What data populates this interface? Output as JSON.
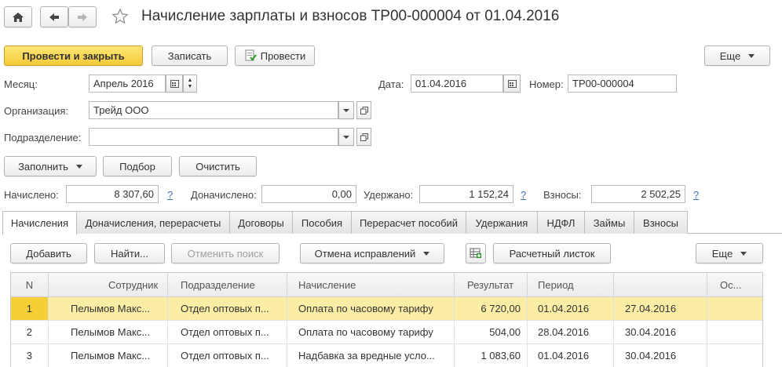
{
  "window": {
    "title": "Начисление зарплаты и взносов ТР00-000004 от 01.04.2016"
  },
  "toolbar": {
    "post_close": "Провести и закрыть",
    "save": "Записать",
    "post": "Провести",
    "more": "Еще"
  },
  "form": {
    "month_label": "Месяц:",
    "month_value": "Апрель 2016",
    "date_label": "Дата:",
    "date_value": "01.04.2016",
    "number_label": "Номер:",
    "number_value": "ТР00-000004",
    "org_label": "Организация:",
    "org_value": "Трейд ООО",
    "dept_label": "Подразделение:",
    "dept_value": ""
  },
  "actions": {
    "fill": "Заполнить",
    "select": "Подбор",
    "clear": "Очистить"
  },
  "totals": {
    "accrued_label": "Начислено:",
    "accrued_value": "8 307,60",
    "extra_label": "Доначислено:",
    "extra_value": "0,00",
    "withheld_label": "Удержано:",
    "withheld_value": "1 152,24",
    "contrib_label": "Взносы:",
    "contrib_value": "2 502,25",
    "help": "?"
  },
  "tabs": [
    {
      "label": "Начисления",
      "active": true
    },
    {
      "label": "Доначисления, перерасчеты"
    },
    {
      "label": "Договоры"
    },
    {
      "label": "Пособия"
    },
    {
      "label": "Перерасчет пособий"
    },
    {
      "label": "Удержания"
    },
    {
      "label": "НДФЛ"
    },
    {
      "label": "Займы"
    },
    {
      "label": "Взносы"
    }
  ],
  "grid_toolbar": {
    "add": "Добавить",
    "find": "Найти...",
    "cancel_search": "Отменить поиск",
    "cancel_corrections": "Отмена исправлений",
    "payslip": "Расчетный листок",
    "more": "Еще"
  },
  "grid": {
    "columns": [
      "N",
      "Сотрудник",
      "Подразделение",
      "Начисление",
      "Результат",
      "Период",
      "",
      "Ос..."
    ],
    "rows": [
      [
        "1",
        "Пелымов Макс...",
        "Отдел оптовых п...",
        "Оплата по часовому тарифу",
        "6 720,00",
        "01.04.2016",
        "27.04.2016",
        ""
      ],
      [
        "2",
        "Пелымов Макс...",
        "Отдел оптовых п...",
        "Оплата по часовому тарифу",
        "504,00",
        "28.04.2016",
        "30.04.2016",
        ""
      ],
      [
        "3",
        "Пелымов Макс...",
        "Отдел оптовых п...",
        "Надбавка за вредные усло...",
        "1 083,60",
        "01.04.2016",
        "30.04.2016",
        ""
      ]
    ]
  },
  "colors": {
    "primary_button": "#f5c93b",
    "selected_row": "#fbeca6",
    "help_link": "#3f6fb9"
  }
}
